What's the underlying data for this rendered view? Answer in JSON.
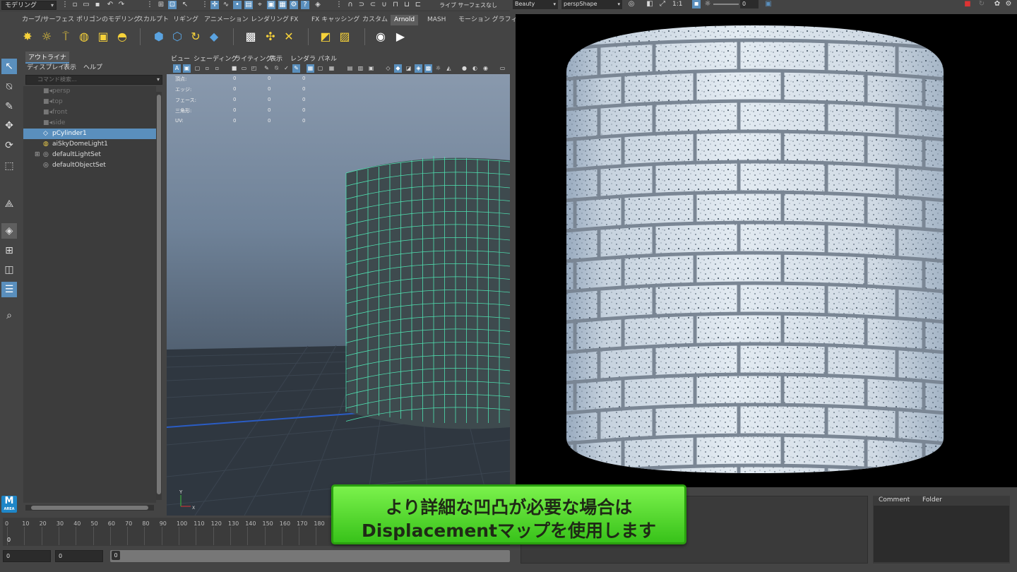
{
  "statusbar": {
    "mode": "モデリング",
    "live_label": "ライブ サーフェスなし"
  },
  "shelf_tabs": [
    "カーブ/サーフェス",
    "ポリゴンのモデリング",
    "スカルプト",
    "リギング",
    "アニメーション",
    "レンダリング",
    "FX",
    "FX キャッシング",
    "カスタム",
    "Arnold",
    "MASH",
    "モーション グラフィックス"
  ],
  "active_shelf_tab": "Arnold",
  "outliner": {
    "tab": "アウトライナ",
    "menus": [
      "ディスプレイ",
      "表示",
      "ヘルプ"
    ],
    "search_placeholder": "コマンド検索...",
    "items": [
      {
        "label": "persp",
        "icon": "camera-icon",
        "state": "dim"
      },
      {
        "label": "top",
        "icon": "camera-icon",
        "state": "dim"
      },
      {
        "label": "front",
        "icon": "camera-icon",
        "state": "dim"
      },
      {
        "label": "side",
        "icon": "camera-icon",
        "state": "dim"
      },
      {
        "label": "pCylinder1",
        "icon": "mesh-icon",
        "state": "selected"
      },
      {
        "label": "aiSkyDomeLight1",
        "icon": "skydome-icon",
        "state": "normal"
      },
      {
        "label": "defaultLightSet",
        "icon": "set-icon",
        "state": "normal"
      },
      {
        "label": "defaultObjectSet",
        "icon": "set-icon",
        "state": "normal"
      }
    ]
  },
  "viewport": {
    "menus": [
      "ビュー",
      "シェーディング",
      "ライティング",
      "表示",
      "レンダラ",
      "パネル"
    ],
    "hud": {
      "rows": [
        {
          "label": "頂点:",
          "values": [
            "0",
            "0",
            "0"
          ]
        },
        {
          "label": "エッジ:",
          "values": [
            "0",
            "0",
            "0"
          ]
        },
        {
          "label": "フェース:",
          "values": [
            "0",
            "0",
            "0"
          ]
        },
        {
          "label": "三角形:",
          "values": [
            "0",
            "0",
            "0"
          ]
        },
        {
          "label": "UV:",
          "values": [
            "0",
            "0",
            "0"
          ]
        }
      ]
    },
    "axis_y": "Y",
    "axis_x": "X"
  },
  "render_view": {
    "aov": "Beauty",
    "camera": "perspShape",
    "ratio": "1:1",
    "exposure": "0",
    "tabs": [
      "Comment",
      "Folder"
    ]
  },
  "timeline": {
    "ticks": [
      "0",
      "10",
      "20",
      "30",
      "40",
      "50",
      "60",
      "70",
      "80",
      "90",
      "100",
      "110",
      "120",
      "130",
      "140",
      "150",
      "160",
      "170",
      "180"
    ],
    "current_frame": "0"
  },
  "rangebar": {
    "start": "0",
    "anim_start": "0",
    "slider_value": "0"
  },
  "caption": {
    "line1": "より詳細な凹凸が必要な場合は",
    "line2": "Displacementマップを使用します"
  },
  "colors": {
    "accent": "#5a8fbd",
    "caption_green": "#5ad832",
    "wireframe": "#4fe0b0"
  }
}
